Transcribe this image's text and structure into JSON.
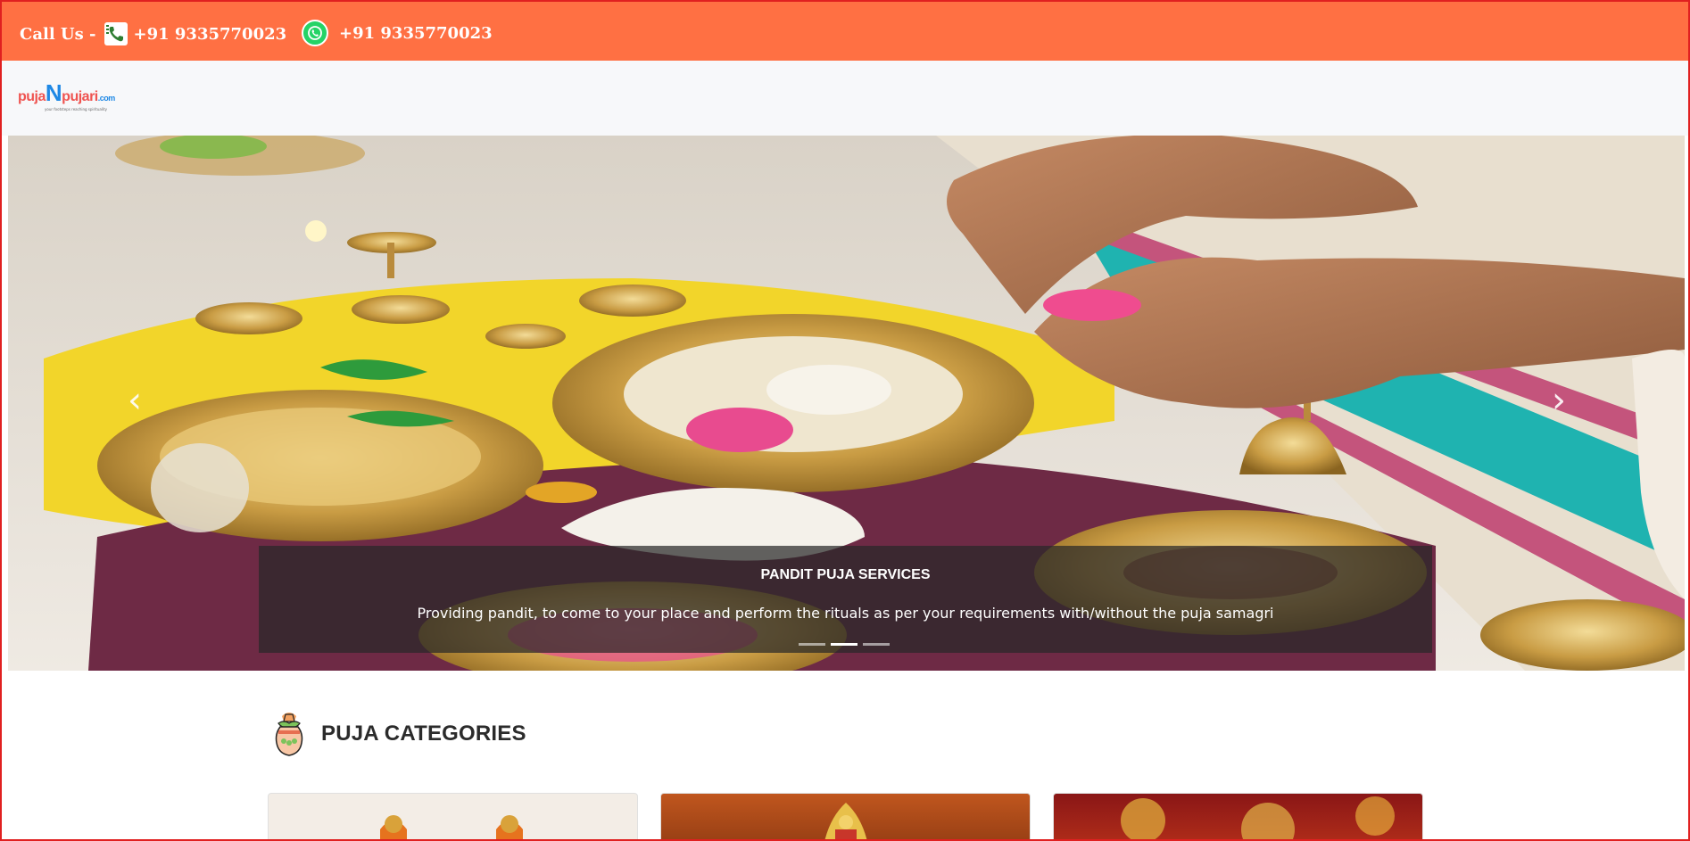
{
  "topbar": {
    "call_label": "Call Us -",
    "call_number": "+91 9335770023",
    "whatsapp_number": "+91 9335770023"
  },
  "brand": {
    "logo_part1": "puja",
    "logo_part2": "N",
    "logo_part3": "pujari",
    "logo_part4": ".com",
    "tagline": "your footsteps reaching spirituality"
  },
  "carousel": {
    "caption_title": "PANDIT PUJA SERVICES",
    "caption_text": "Providing pandit, to come to your place and perform the rituals as per your requirements with/without the puja samagri",
    "prev_symbol": "‹",
    "next_symbol": "›",
    "slide_count": 3,
    "active_slide": 2
  },
  "categories": {
    "heading": "PUJA CATEGORIES"
  },
  "colors": {
    "topbar": "#ff7043",
    "navbar": "#f7f8fa",
    "caption_bg": "rgba(40,40,40,0.72)"
  }
}
